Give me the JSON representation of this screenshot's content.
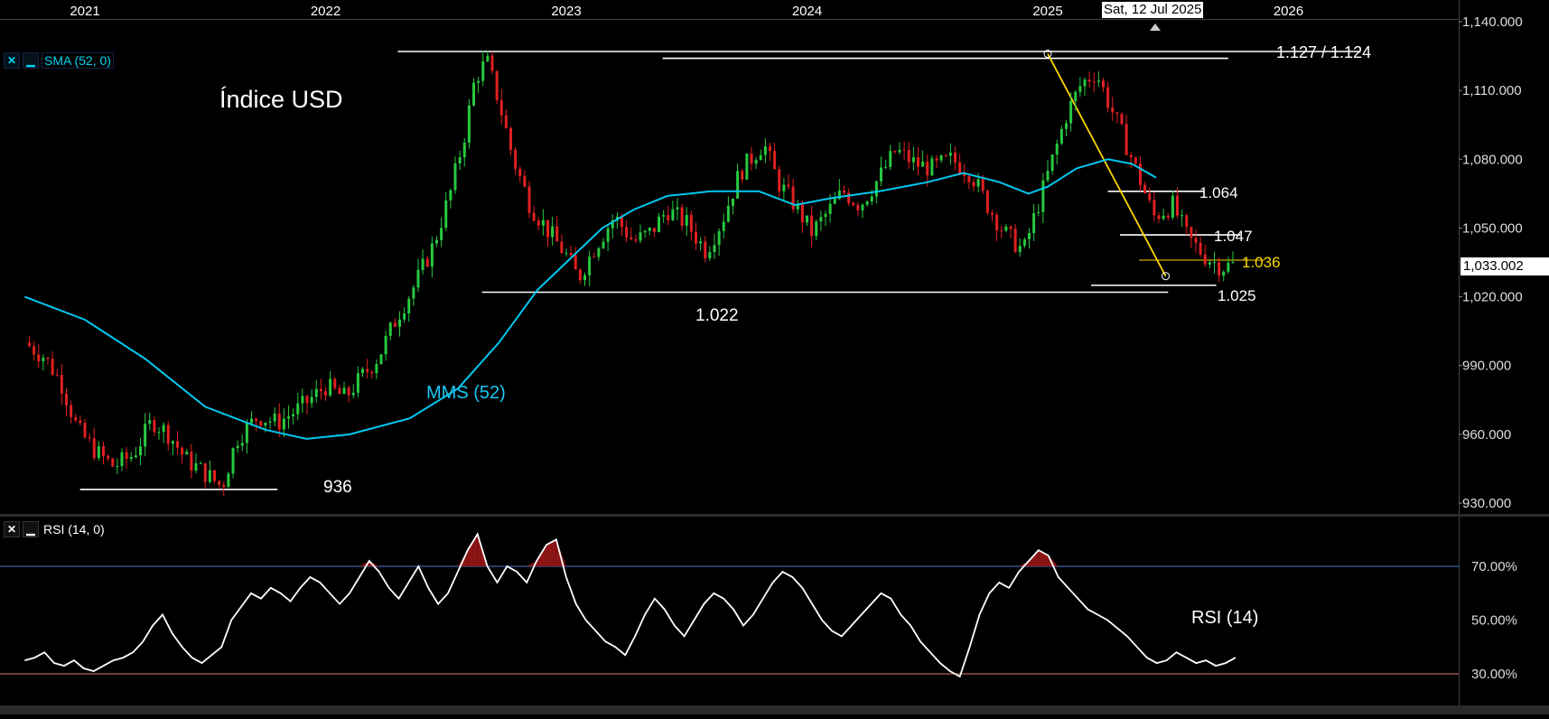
{
  "chart_data": [
    {
      "type": "candlestick",
      "title": "Índice USD",
      "indicator_label": "SMA (52, 0)",
      "x_ticks": [
        "2021",
        "2022",
        "2023",
        "2024",
        "2025",
        "2026"
      ],
      "y_ticks": [
        "930.000",
        "960.000",
        "990.000",
        "1,020.000",
        "1,050.000",
        "1,080.000",
        "1,110.000",
        "1,140.000"
      ],
      "ylim": [
        925,
        1143
      ],
      "xlim": [
        2020.75,
        2026.75
      ],
      "crosshair_date": "Sat, 12 Jul 2025",
      "last_price": "1,033.002",
      "series": [
        {
          "name": "MMS (52)",
          "color": "#00c8f0",
          "points": [
            [
              2020.75,
              1020
            ],
            [
              2021.0,
              1010
            ],
            [
              2021.25,
              993
            ],
            [
              2021.5,
              972
            ],
            [
              2021.75,
              962
            ],
            [
              2021.92,
              958
            ],
            [
              2022.1,
              960
            ],
            [
              2022.35,
              967
            ],
            [
              2022.55,
              980
            ],
            [
              2022.72,
              1000
            ],
            [
              2022.88,
              1023
            ],
            [
              2023.0,
              1035
            ],
            [
              2023.15,
              1050
            ],
            [
              2023.28,
              1058
            ],
            [
              2023.42,
              1064
            ],
            [
              2023.6,
              1066
            ],
            [
              2023.8,
              1066
            ],
            [
              2023.95,
              1060
            ],
            [
              2024.1,
              1063
            ],
            [
              2024.3,
              1066
            ],
            [
              2024.5,
              1070
            ],
            [
              2024.65,
              1074
            ],
            [
              2024.8,
              1070
            ],
            [
              2024.92,
              1065
            ],
            [
              2025.0,
              1068
            ],
            [
              2025.12,
              1076
            ],
            [
              2025.25,
              1080
            ],
            [
              2025.35,
              1078
            ],
            [
              2025.45,
              1072
            ]
          ]
        }
      ],
      "levels": [
        {
          "label": "1.127 / 1.124",
          "value": 1127,
          "x_start": 2022.3,
          "x_end": 2026.3
        },
        {
          "label": "1.127 / 1.124",
          "value": 1124,
          "x_start": 2023.4,
          "x_end": 2025.75
        },
        {
          "label": "1.064",
          "value": 1066,
          "x_start": 2025.25,
          "x_end": 2025.65
        },
        {
          "label": "1.047",
          "value": 1047,
          "x_start": 2025.3,
          "x_end": 2025.8
        },
        {
          "label": "1.036",
          "value": 1036,
          "x_start": 2025.38,
          "x_end": 2025.9
        },
        {
          "label": "1.025",
          "value": 1025,
          "x_start": 2025.18,
          "x_end": 2025.7
        },
        {
          "label": "1.022",
          "value": 1022,
          "x_start": 2022.65,
          "x_end": 2025.5
        },
        {
          "label": "936",
          "value": 936,
          "x_start": 2020.98,
          "x_end": 2021.8
        }
      ],
      "trendline": {
        "from": [
          2025.0,
          1126
        ],
        "to": [
          2025.49,
          1029
        ],
        "color": "#ffd400"
      },
      "annotations": {
        "sma_text": "MMS (52)",
        "level_1127": "1.127 / 1.124",
        "level_1064": "1.064",
        "level_1047": "1.047",
        "level_1036": "1.036",
        "level_1025": "1.025",
        "level_1022": "1.022",
        "level_936": "936"
      },
      "close_path": [
        [
          2020.75,
          1000
        ],
        [
          2020.83,
          994
        ],
        [
          2020.9,
          983
        ],
        [
          2020.97,
          962
        ],
        [
          2021.05,
          952
        ],
        [
          2021.12,
          946
        ],
        [
          2021.2,
          951
        ],
        [
          2021.28,
          966
        ],
        [
          2021.35,
          960
        ],
        [
          2021.42,
          949
        ],
        [
          2021.5,
          943
        ],
        [
          2021.57,
          937
        ],
        [
          2021.63,
          958
        ],
        [
          2021.72,
          968
        ],
        [
          2021.8,
          965
        ],
        [
          2021.9,
          972
        ],
        [
          2022.0,
          981
        ],
        [
          2022.08,
          976
        ],
        [
          2022.15,
          985
        ],
        [
          2022.22,
          994
        ],
        [
          2022.3,
          1012
        ],
        [
          2022.37,
          1025
        ],
        [
          2022.45,
          1043
        ],
        [
          2022.52,
          1066
        ],
        [
          2022.58,
          1092
        ],
        [
          2022.62,
          1115
        ],
        [
          2022.67,
          1123
        ],
        [
          2022.72,
          1105
        ],
        [
          2022.78,
          1080
        ],
        [
          2022.85,
          1060
        ],
        [
          2022.93,
          1048
        ],
        [
          2023.0,
          1038
        ],
        [
          2023.05,
          1028
        ],
        [
          2023.12,
          1042
        ],
        [
          2023.2,
          1055
        ],
        [
          2023.28,
          1044
        ],
        [
          2023.35,
          1048
        ],
        [
          2023.42,
          1058
        ],
        [
          2023.5,
          1052
        ],
        [
          2023.58,
          1040
        ],
        [
          2023.65,
          1054
        ],
        [
          2023.72,
          1074
        ],
        [
          2023.78,
          1082
        ],
        [
          2023.82,
          1087
        ],
        [
          2023.88,
          1070
        ],
        [
          2023.95,
          1060
        ],
        [
          2024.02,
          1048
        ],
        [
          2024.08,
          1056
        ],
        [
          2024.15,
          1066
        ],
        [
          2024.22,
          1060
        ],
        [
          2024.3,
          1072
        ],
        [
          2024.37,
          1084
        ],
        [
          2024.45,
          1078
        ],
        [
          2024.52,
          1076
        ],
        [
          2024.6,
          1080
        ],
        [
          2024.68,
          1074
        ],
        [
          2024.75,
          1060
        ],
        [
          2024.82,
          1048
        ],
        [
          2024.9,
          1040
        ],
        [
          2024.96,
          1060
        ],
        [
          2025.02,
          1080
        ],
        [
          2025.08,
          1100
        ],
        [
          2025.14,
          1113
        ],
        [
          2025.2,
          1118
        ],
        [
          2025.26,
          1103
        ],
        [
          2025.32,
          1088
        ],
        [
          2025.38,
          1072
        ],
        [
          2025.44,
          1055
        ],
        [
          2025.52,
          1060
        ],
        [
          2025.58,
          1046
        ],
        [
          2025.65,
          1038
        ],
        [
          2025.72,
          1033
        ],
        [
          2025.78,
          1034
        ]
      ]
    },
    {
      "type": "line",
      "title": "",
      "indicator_label": "RSI (14, 0)",
      "y_ticks": [
        "30.00%",
        "50.00%",
        "70.00%"
      ],
      "ylim": [
        20,
        86
      ],
      "overbought": 70,
      "oversold": 30,
      "series": [
        {
          "name": "RSI (14)",
          "color": "#ffffff",
          "values": [
            35,
            36,
            38,
            34,
            33,
            35,
            32,
            31,
            33,
            35,
            36,
            38,
            42,
            48,
            52,
            45,
            40,
            36,
            34,
            37,
            40,
            50,
            55,
            60,
            58,
            62,
            60,
            57,
            62,
            66,
            64,
            60,
            56,
            60,
            66,
            72,
            68,
            62,
            58,
            64,
            70,
            62,
            56,
            60,
            68,
            76,
            82,
            70,
            64,
            70,
            68,
            64,
            72,
            78,
            80,
            66,
            56,
            50,
            46,
            42,
            40,
            37,
            44,
            52,
            58,
            54,
            48,
            44,
            50,
            56,
            60,
            58,
            54,
            48,
            52,
            58,
            64,
            68,
            66,
            62,
            56,
            50,
            46,
            44,
            48,
            52,
            56,
            60,
            58,
            52,
            48,
            42,
            38,
            34,
            31,
            29,
            40,
            52,
            60,
            64,
            62,
            68,
            72,
            76,
            74,
            66,
            62,
            58,
            54,
            52,
            50,
            47,
            44,
            40,
            36,
            34,
            35,
            38,
            36,
            34,
            35,
            33,
            34,
            36
          ]
        }
      ],
      "annotations": {
        "rsi_text": "RSI (14)"
      }
    }
  ]
}
